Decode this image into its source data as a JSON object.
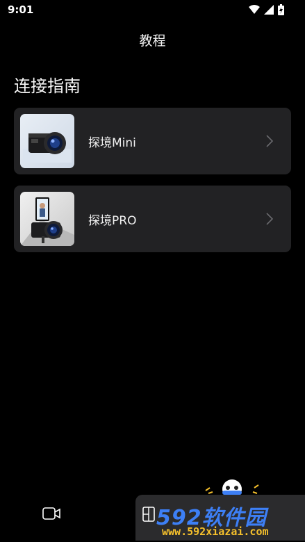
{
  "status_bar": {
    "time": "9:01"
  },
  "header": {
    "title": "教程"
  },
  "section": {
    "title": "连接指南"
  },
  "devices": [
    {
      "name": "探境Mini"
    },
    {
      "name": "探境PRO"
    }
  ],
  "watermark": {
    "main": "592软件园",
    "sub": "www.592xiazai.com"
  },
  "icons": {
    "status": [
      "wifi-icon",
      "signal-icon",
      "battery-icon"
    ],
    "row": "chevron-right-icon",
    "tabs": [
      "video-camera-icon",
      "album-icon"
    ]
  }
}
